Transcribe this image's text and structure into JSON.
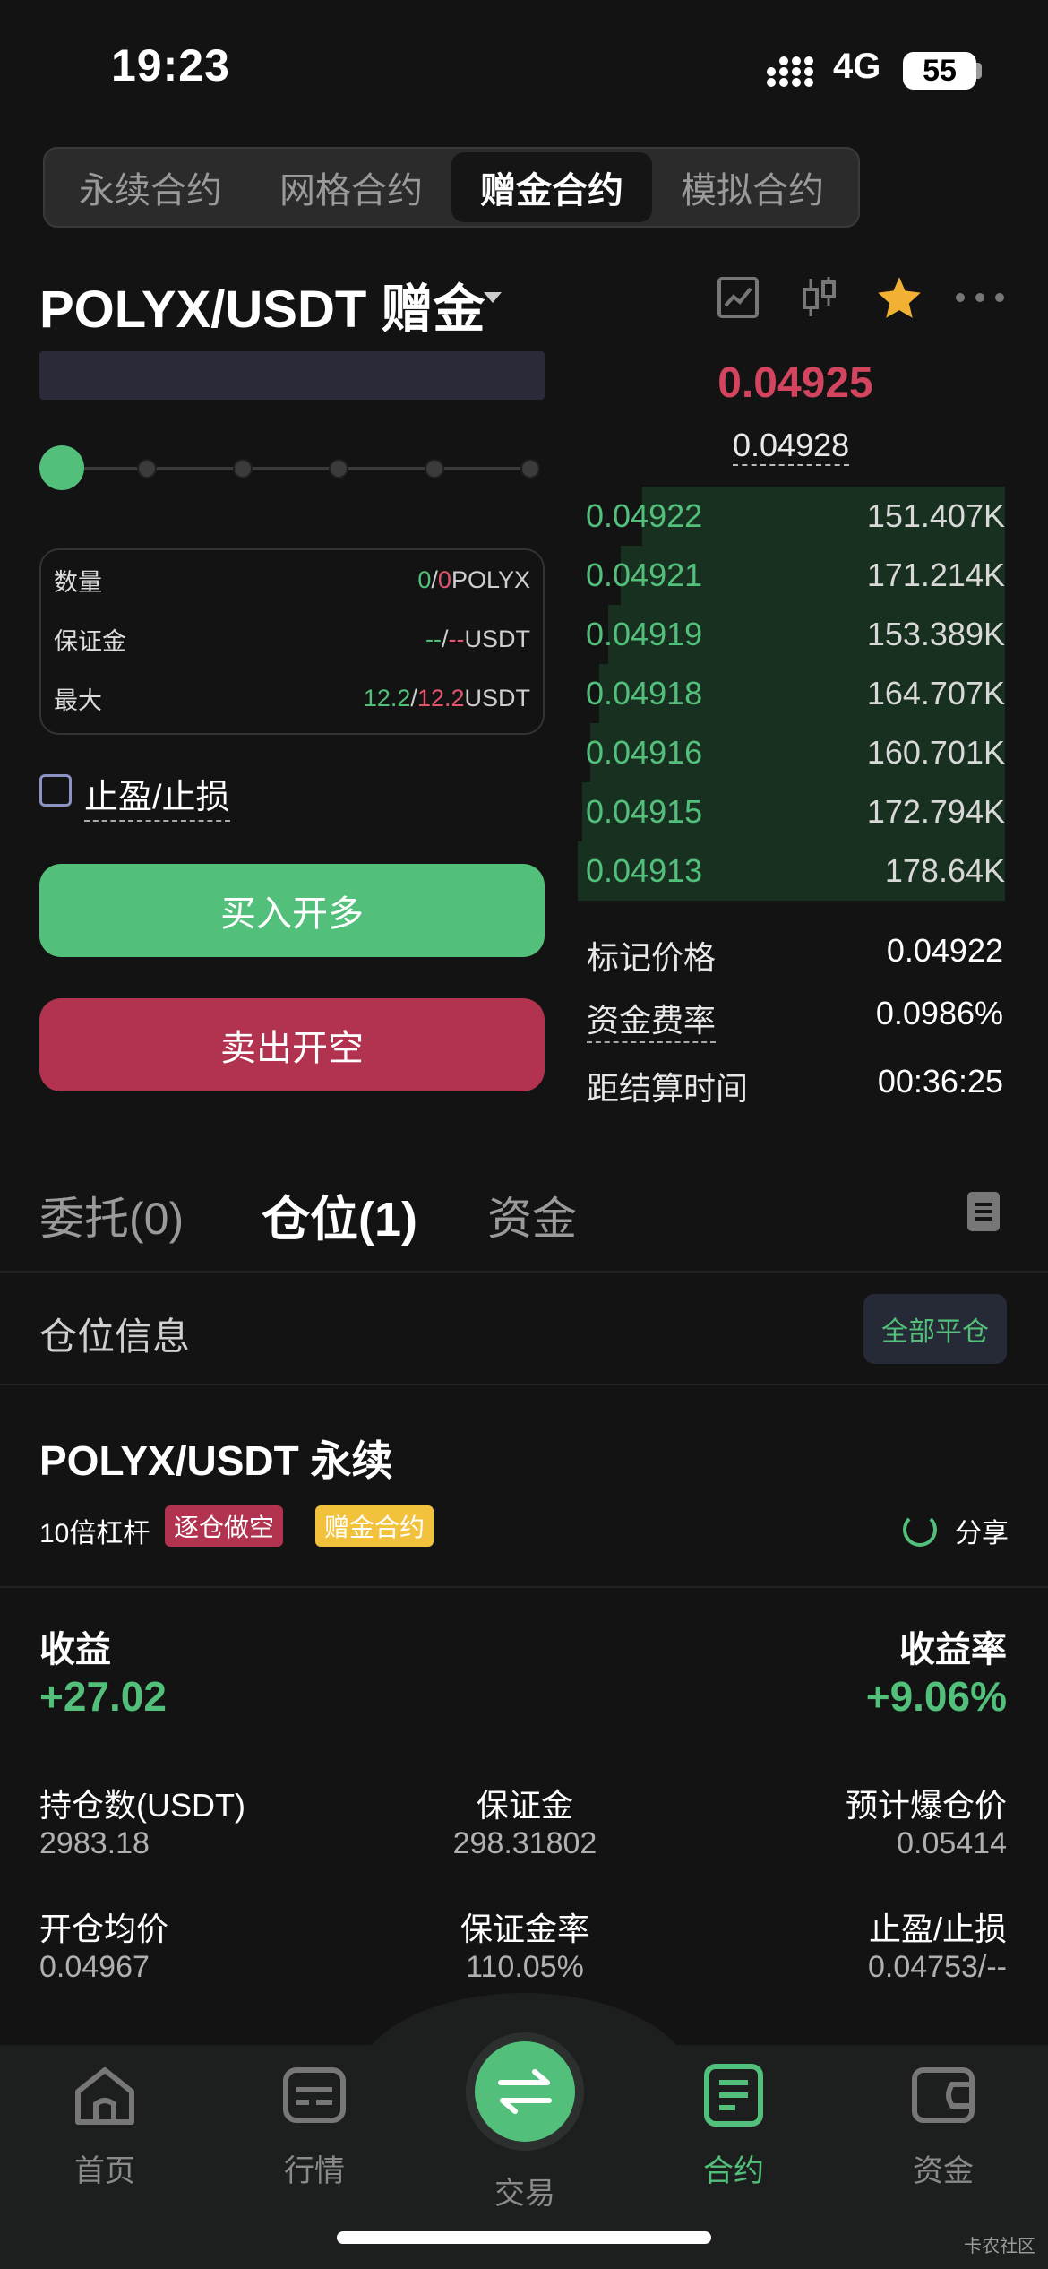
{
  "status_bar": {
    "time": "19:23",
    "network": "4G",
    "battery": "55"
  },
  "top_tabs": [
    {
      "label": "永续合约",
      "active": false
    },
    {
      "label": "网格合约",
      "active": false
    },
    {
      "label": "赠金合约",
      "active": true
    },
    {
      "label": "模拟合约",
      "active": false
    }
  ],
  "pair": {
    "title": "POLYX/USDT 赠金"
  },
  "form": {
    "quantity_label": "数量",
    "quantity_buy": "0",
    "quantity_sell": "0",
    "quantity_unit": "POLYX",
    "margin_label": "保证金",
    "margin_buy": "--",
    "margin_sell": "--",
    "margin_unit": "USDT",
    "max_label": "最大",
    "max_buy": "12.2",
    "max_sell": "12.2",
    "max_unit": "USDT",
    "sep": "/",
    "tp_sl_label": "止盈/止损",
    "buy_label": "买入开多",
    "sell_label": "卖出开空"
  },
  "order_book": {
    "last_price": "0.04925",
    "mark_price": "0.04928",
    "bids": [
      {
        "price": "0.04922",
        "qty": "151.407K",
        "depth": 0.84
      },
      {
        "price": "0.04921",
        "qty": "171.214K",
        "depth": 0.89
      },
      {
        "price": "0.04919",
        "qty": "153.389K",
        "depth": 0.92
      },
      {
        "price": "0.04918",
        "qty": "164.707K",
        "depth": 0.94
      },
      {
        "price": "0.04916",
        "qty": "160.701K",
        "depth": 0.96
      },
      {
        "price": "0.04915",
        "qty": "172.794K",
        "depth": 0.98
      },
      {
        "price": "0.04913",
        "qty": "178.64K",
        "depth": 0.99
      }
    ]
  },
  "stats": {
    "mark_price_label": "标记价格",
    "mark_price_value": "0.04922",
    "funding_label": "资金费率",
    "funding_value": "0.0986%",
    "settle_label": "距结算时间",
    "settle_value": "00:36:25"
  },
  "lower_tabs": {
    "orders": "委托(0)",
    "positions": "仓位(1)",
    "funds": "资金"
  },
  "position": {
    "section_title": "仓位信息",
    "close_all": "全部平仓",
    "pair": "POLYX/USDT 永续",
    "leverage": "10倍杠杆",
    "badge_mode": "逐仓做空",
    "badge_type": "赠金合约",
    "share": "分享",
    "pnl_label": "收益",
    "pnl_value": "+27.02",
    "roe_label": "收益率",
    "roe_value": "+9.06%",
    "size_label": "持仓数(USDT)",
    "size_value": "2983.18",
    "margin_label": "保证金",
    "margin_value": "298.31802",
    "liq_label": "预计爆仓价",
    "liq_value": "0.05414",
    "entry_label": "开仓均价",
    "entry_value": "0.04967",
    "margin_ratio_label": "保证金率",
    "margin_ratio_value": "110.05%",
    "tpsl_label": "止盈/止损",
    "tpsl_value": "0.04753/--"
  },
  "nav": [
    {
      "label": "首页",
      "icon": "home-icon",
      "active": false
    },
    {
      "label": "行情",
      "icon": "market-icon",
      "active": false
    },
    {
      "label": "交易",
      "icon": "swap-icon",
      "active": false
    },
    {
      "label": "合约",
      "icon": "contract-icon",
      "active": true
    },
    {
      "label": "资金",
      "icon": "wallet-icon",
      "active": false
    }
  ],
  "watermark": "卡农社区",
  "colors": {
    "green": "#52c07b",
    "red": "#d3445e",
    "background": "#131313"
  }
}
